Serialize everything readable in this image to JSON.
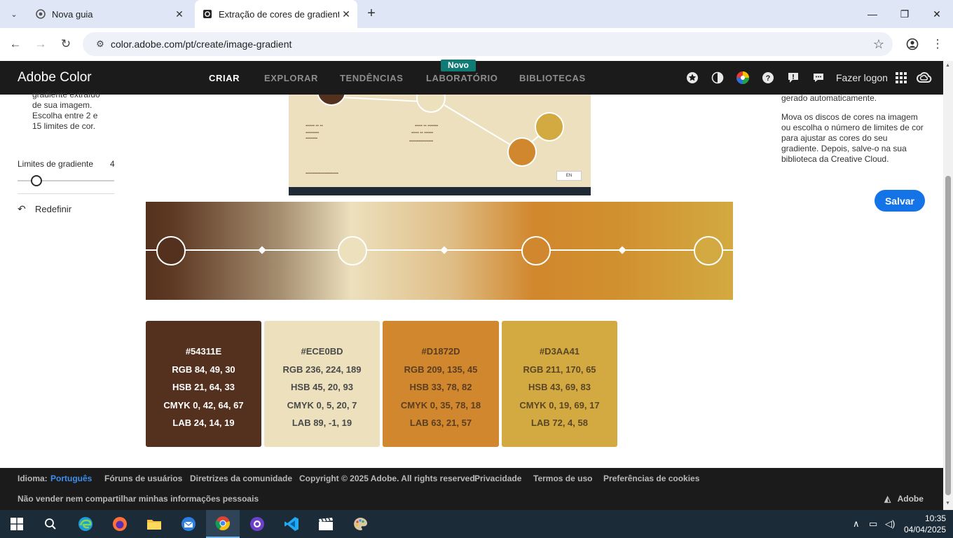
{
  "browser": {
    "tabs": [
      {
        "title": "Nova guia",
        "active": false
      },
      {
        "title": "Extração de cores de gradiente",
        "active": true
      }
    ],
    "url": "color.adobe.com/pt/create/image-gradient"
  },
  "header": {
    "brand": "Adobe Color",
    "nav": [
      "CRIAR",
      "EXPLORAR",
      "TENDÊNCIAS",
      "LABORATÓRIO",
      "BIBLIOTECAS"
    ],
    "badge": "Novo",
    "login": "Fazer logon"
  },
  "left_panel": {
    "description": "gradiente extraído de sua imagem. Escolha entre 2 e 15 limites de cor.",
    "limits_label": "Limites de gradiente",
    "limits_value": "4",
    "reset_label": "Redefinir"
  },
  "right_panel": {
    "text_1": "gerado automaticamente.",
    "text_2": "Mova os discos de cores na imagem ou escolha o número de limites de cor para ajustar as cores do seu gradiente. Depois, salve-o na sua biblioteca da Creative Cloud.",
    "save_label": "Salvar"
  },
  "preview": {
    "lang": "EN"
  },
  "swatches": [
    {
      "hex": "#54311E",
      "rgb": "RGB 84, 49, 30",
      "hsb": "HSB 21, 64, 33",
      "cmyk": "CMYK 0, 42, 64, 67",
      "lab": "LAB 24, 14, 19",
      "color": "#54311e",
      "text_color": "#ffffff"
    },
    {
      "hex": "#ECE0BD",
      "rgb": "RGB 236, 224, 189",
      "hsb": "HSB 45, 20, 93",
      "cmyk": "CMYK 0, 5, 20, 7",
      "lab": "LAB 89, -1, 19",
      "color": "#ece0bd",
      "text_color": "#4a4a4a"
    },
    {
      "hex": "#D1872D",
      "rgb": "RGB 209, 135, 45",
      "hsb": "HSB 33, 78, 82",
      "cmyk": "CMYK 0, 35, 78, 18",
      "lab": "LAB 63, 21, 57",
      "color": "#d1872d",
      "text_color": "#5a3d22"
    },
    {
      "hex": "#D3AA41",
      "rgb": "RGB 211, 170, 65",
      "hsb": "HSB 43, 69, 83",
      "cmyk": "CMYK 0, 19, 69, 17",
      "lab": "LAB 72, 4, 58",
      "color": "#d3aa41",
      "text_color": "#5a4626"
    }
  ],
  "footer": {
    "lang_label": "Idioma:",
    "lang_value": "Português",
    "links": [
      "Fóruns de usuários",
      "Diretrizes da comunidade",
      "Copyright © 2025 Adobe. All rights reserved.",
      "Privacidade",
      "Termos de uso",
      "Preferências de cookies"
    ],
    "do_not_sell": "Não vender nem compartilhar minhas informações pessoais",
    "adobe": "Adobe"
  },
  "taskbar": {
    "time": "10:35",
    "date": "04/04/2025"
  }
}
